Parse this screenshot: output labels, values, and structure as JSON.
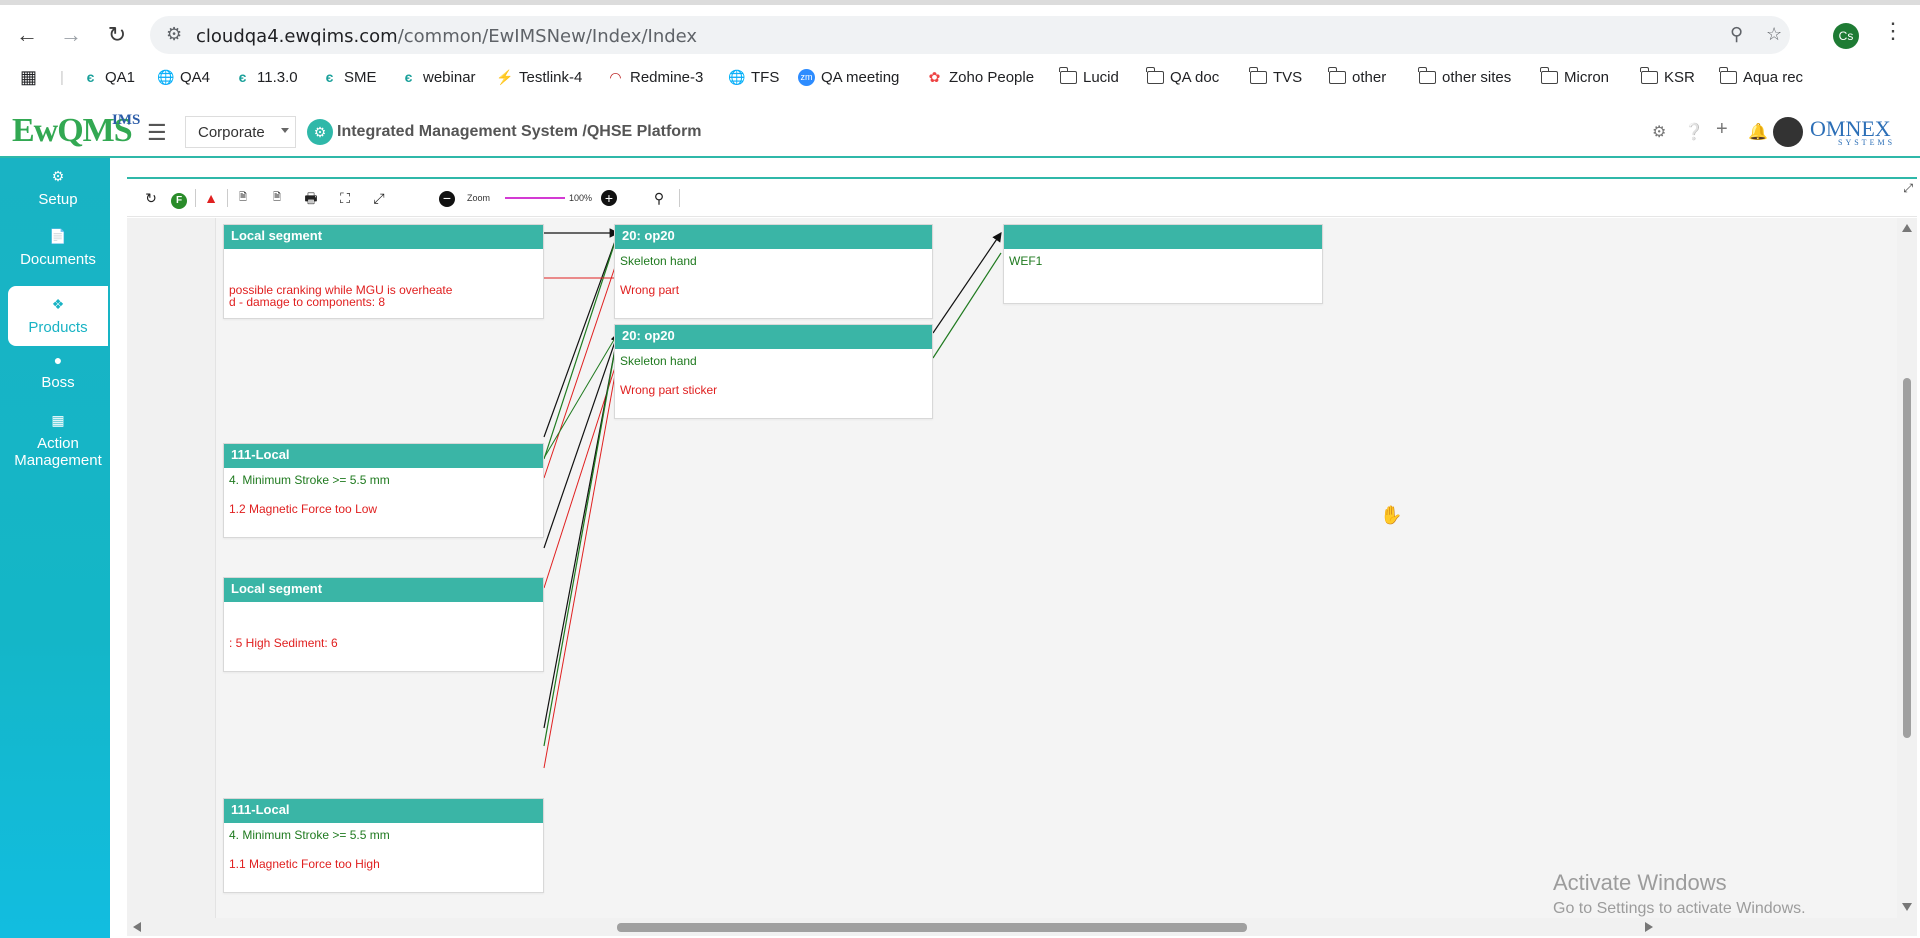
{
  "browser": {
    "url_host": "cloudqa4.ewqims.com",
    "url_path": "/common/EwIMSNew/Index/Index",
    "profile_initials": "Cs",
    "bookmarks": [
      {
        "label": "QA1",
        "icon": "e-icon"
      },
      {
        "label": "QA4",
        "icon": "globe-icon"
      },
      {
        "label": "11.3.0",
        "icon": "e-icon"
      },
      {
        "label": "SME",
        "icon": "e-icon"
      },
      {
        "label": "webinar",
        "icon": "e-icon"
      },
      {
        "label": "Testlink-4",
        "icon": "testlink-icon"
      },
      {
        "label": "Redmine-3",
        "icon": "redmine-icon"
      },
      {
        "label": "TFS",
        "icon": "globe-icon"
      },
      {
        "label": "QA meeting",
        "icon": "zoom-icon"
      },
      {
        "label": "Zoho People",
        "icon": "zoho-icon"
      },
      {
        "label": "Lucid",
        "icon": "folder-icon"
      },
      {
        "label": "QA doc",
        "icon": "folder-icon"
      },
      {
        "label": "TVS",
        "icon": "folder-icon"
      },
      {
        "label": "other",
        "icon": "folder-icon"
      },
      {
        "label": "other sites",
        "icon": "folder-icon"
      },
      {
        "label": "Micron",
        "icon": "folder-icon"
      },
      {
        "label": "KSR",
        "icon": "folder-icon"
      },
      {
        "label": "Aqua rec",
        "icon": "folder-icon"
      }
    ]
  },
  "header": {
    "logo_main": "EwQMS",
    "logo_sup": "IMS",
    "logo_sub": "QMS",
    "company": "Corporate",
    "platform_title": "Integrated Management System /QHSE Platform",
    "brand": "OMNEX",
    "brand_sub": "SYSTEMS",
    "accent_color": "#2fb8a9"
  },
  "sidebar": {
    "items": [
      {
        "label": "Setup",
        "icon": "gears-icon"
      },
      {
        "label": "Documents",
        "icon": "documents-icon"
      },
      {
        "label": "Products",
        "icon": "products-icon",
        "active": true
      },
      {
        "label": "Boss",
        "icon": "user-icon"
      },
      {
        "label": "Action Management",
        "icon": "building-icon"
      }
    ]
  },
  "toolbar": {
    "zoom_label": "Zoom",
    "zoom_value": "100%"
  },
  "diagram": {
    "nodes": [
      {
        "title": "Local segment",
        "lines": [
          {
            "text": "",
            "color": "green"
          },
          {
            "text": "possible cranking while MGU is overheate",
            "color": "red"
          },
          {
            "text": "d - damage to components: 8",
            "color": "red"
          }
        ]
      },
      {
        "title": "111-Local",
        "lines": [
          {
            "text": " 4. Minimum Stroke  >= 5.5 mm",
            "color": "green"
          },
          {
            "text": "1.2  Magnetic Force too Low",
            "color": "red"
          }
        ]
      },
      {
        "title": "Local segment",
        "lines": [
          {
            "text": ": 5  High Sediment: 6",
            "color": "red"
          }
        ]
      },
      {
        "title": "111-Local",
        "lines": [
          {
            "text": " 4. Minimum Stroke  >= 5.5 mm",
            "color": "green"
          },
          {
            "text": "1.1  Magnetic Force too High",
            "color": "red"
          }
        ]
      },
      {
        "title": "20: op20",
        "lines": [
          {
            "text": "Skeleton hand",
            "color": "green"
          },
          {
            "text": "Wrong part",
            "color": "red"
          }
        ]
      },
      {
        "title": "20: op20",
        "lines": [
          {
            "text": "Skeleton hand",
            "color": "green"
          },
          {
            "text": "Wrong part sticker",
            "color": "red"
          }
        ]
      },
      {
        "title": "",
        "lines": [
          {
            "text": "WEF1",
            "color": "green"
          }
        ]
      }
    ]
  },
  "watermark": {
    "line1": "Activate Windows",
    "line2": "Go to Settings to activate Windows."
  }
}
